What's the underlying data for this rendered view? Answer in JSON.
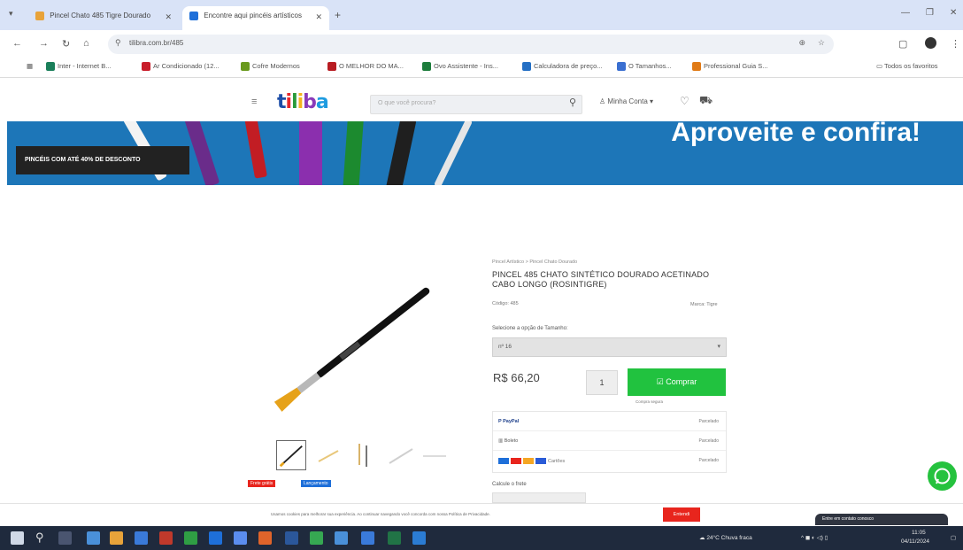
{
  "browser": {
    "tabs": [
      {
        "label": "Pincel Chato 485 Tigre Dourado",
        "favicon_color": "#e8a33a"
      },
      {
        "label": "Encontre aqui pincéis artísticos",
        "favicon_color": "#1e6fd9"
      }
    ],
    "new_tab_label": "+",
    "url": "tilibra.com.br/485",
    "bookmarks": [
      {
        "label": "Inter - Internet B...",
        "color": "#1a7f5a"
      },
      {
        "label": "Ar Condicionado (12...",
        "color": "#c81d2a"
      },
      {
        "label": "Cofre Modernos",
        "color": "#6a9a1e"
      },
      {
        "label": "O MELHOR DO MA...",
        "color": "#b81c22"
      },
      {
        "label": "Ovo Assistente - Ins...",
        "color": "#1d7d3c"
      },
      {
        "label": "Calculadora de preço...",
        "color": "#246fc4"
      },
      {
        "label": "O Tamanhos...",
        "color": "#3a6fd1"
      },
      {
        "label": "Professional Guia S...",
        "color": "#e07a16"
      }
    ],
    "all_bookmarks_label": "Todos os favoritos"
  },
  "site": {
    "logo": {
      "letters": [
        "t",
        "i",
        "l",
        "i",
        "b",
        "a"
      ],
      "colors": [
        "#1d4ea8",
        "#e8282c",
        "#2a9a3b",
        "#f5b320",
        "#8a3ab9",
        "#1d9be0"
      ]
    },
    "search_placeholder": "O que você procura?",
    "account_label": "Minha Conta",
    "banner_text": "Aproveite e confira!",
    "banner_badge": "PINCÉIS COM ATÉ 40% DE DESCONTO"
  },
  "product": {
    "breadcrumb": "Pincel Artístico > Pincel Chato Dourado",
    "title": "PINCEL 485 CHATO SINTÉTICO DOURADO ACETINADO CABO LONGO (ROSINTIGRE)",
    "ref": "Código: 485",
    "brand": "Marca: Tigre",
    "select_label": "Selecione a opção de Tamanho:",
    "select_value": "nº 16",
    "price": "R$ 66,20",
    "quantity": "1",
    "buy_label": "Comprar",
    "buy_sub": "Compra segura",
    "payments": [
      {
        "name": "PayPal",
        "value": "Parcelado"
      },
      {
        "name": "Boleto",
        "value": "Parcelado"
      },
      {
        "name": "Cartões",
        "value": "Parcelado"
      }
    ],
    "tags": [
      {
        "label": "Frete grátis",
        "color": "#e8251d"
      },
      {
        "label": "Lançamento",
        "color": "#1e6fd9"
      }
    ],
    "shipping_label": "Calcule o frete"
  },
  "cookie": {
    "text": "Usamos cookies para melhorar sua experiência. Ao continuar navegando você concorda com nossa Política de Privacidade.",
    "button": "Entendi",
    "chat_label": "Entre em contato conosco"
  },
  "taskbar": {
    "weather": "24°C Chuva fraca",
    "time": "11:05",
    "date": "04/11/2024"
  }
}
